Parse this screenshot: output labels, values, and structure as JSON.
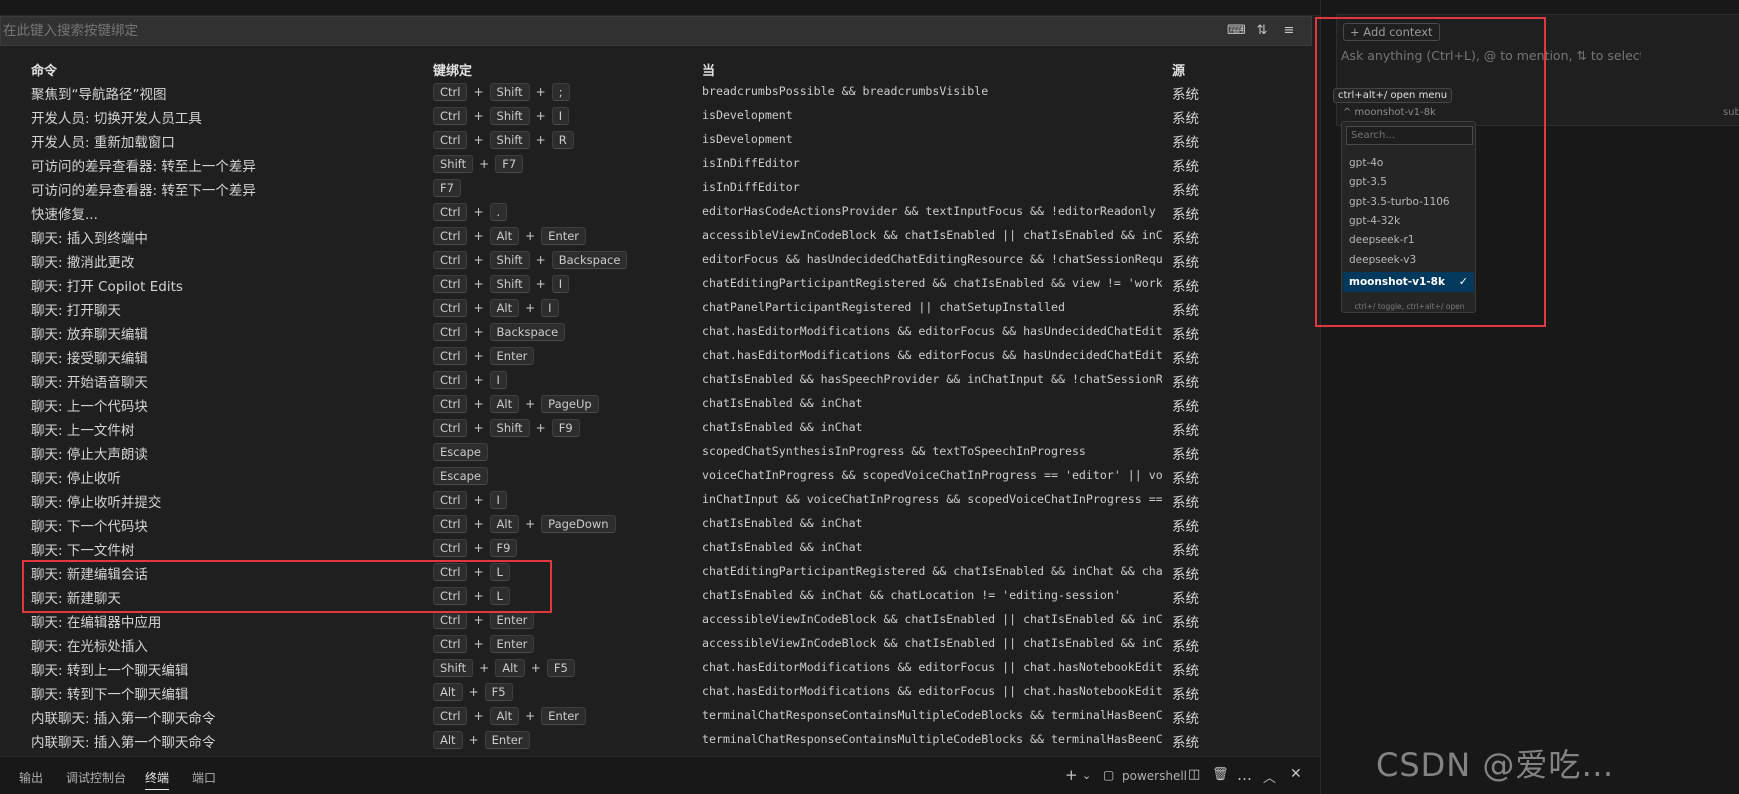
{
  "search": {
    "placeholder": "在此键入搜索按键绑定"
  },
  "columns": {
    "command": "命令",
    "keybinding": "键绑定",
    "when": "当",
    "source": "源"
  },
  "rows": [
    {
      "cmd": "聚焦到“导航路径”视图",
      "keys": [
        "Ctrl",
        "Shift",
        ";"
      ],
      "when": "breadcrumbsPossible && breadcrumbsVisible",
      "src": "系统"
    },
    {
      "cmd": "开发人员: 切换开发人员工具",
      "keys": [
        "Ctrl",
        "Shift",
        "I"
      ],
      "when": "isDevelopment",
      "src": "系统"
    },
    {
      "cmd": "开发人员: 重新加载窗口",
      "keys": [
        "Ctrl",
        "Shift",
        "R"
      ],
      "when": "isDevelopment",
      "src": "系统"
    },
    {
      "cmd": "可访问的差异查看器: 转至上一个差异",
      "keys": [
        "Shift",
        "F7"
      ],
      "when": "isInDiffEditor",
      "src": "系统"
    },
    {
      "cmd": "可访问的差异查看器: 转至下一个差异",
      "keys": [
        "F7"
      ],
      "when": "isInDiffEditor",
      "src": "系统"
    },
    {
      "cmd": "快速修复...",
      "keys": [
        "Ctrl",
        "."
      ],
      "when": "editorHasCodeActionsProvider && textInputFocus && !editorReadonly",
      "src": "系统"
    },
    {
      "cmd": "聊天: 插入到终端中",
      "keys": [
        "Ctrl",
        "Alt",
        "Enter"
      ],
      "when": "accessibleViewInCodeBlock && chatIsEnabled || chatIsEnabled && inChat",
      "src": "系统"
    },
    {
      "cmd": "聊天: 撤消此更改",
      "keys": [
        "Ctrl",
        "Shift",
        "Backspace"
      ],
      "when": "editorFocus && hasUndecidedChatEditingResource && !chatSessionRequestI…",
      "src": "系统"
    },
    {
      "cmd": "聊天: 打开 Copilot Edits",
      "keys": [
        "Ctrl",
        "Shift",
        "I"
      ],
      "when": "chatEditingParticipantRegistered && chatIsEnabled && view != 'workbenc…",
      "src": "系统"
    },
    {
      "cmd": "聊天: 打开聊天",
      "keys": [
        "Ctrl",
        "Alt",
        "I"
      ],
      "when": "chatPanelParticipantRegistered || chatSetupInstalled",
      "src": "系统"
    },
    {
      "cmd": "聊天: 放弃聊天编辑",
      "keys": [
        "Ctrl",
        "Backspace"
      ],
      "when": "chat.hasEditorModifications && editorFocus && hasUndecidedChatEditingR…",
      "src": "系统"
    },
    {
      "cmd": "聊天: 接受聊天编辑",
      "keys": [
        "Ctrl",
        "Enter"
      ],
      "when": "chat.hasEditorModifications && editorFocus && hasUndecidedChatEditingR…",
      "src": "系统"
    },
    {
      "cmd": "聊天: 开始语音聊天",
      "keys": [
        "Ctrl",
        "I"
      ],
      "when": "chatIsEnabled && hasSpeechProvider && inChatInput && !chatSessionReque…",
      "src": "系统"
    },
    {
      "cmd": "聊天: 上一个代码块",
      "keys": [
        "Ctrl",
        "Alt",
        "PageUp"
      ],
      "when": "chatIsEnabled && inChat",
      "src": "系统"
    },
    {
      "cmd": "聊天: 上一文件树",
      "keys": [
        "Ctrl",
        "Shift",
        "F9"
      ],
      "when": "chatIsEnabled && inChat",
      "src": "系统"
    },
    {
      "cmd": "聊天: 停止大声朗读",
      "keys": [
        "Escape"
      ],
      "when": "scopedChatSynthesisInProgress && textToSpeechInProgress",
      "src": "系统"
    },
    {
      "cmd": "聊天: 停止收听",
      "keys": [
        "Escape"
      ],
      "when": "voiceChatInProgress && scopedVoiceChatInProgress == 'editor' || voiceC…",
      "src": "系统"
    },
    {
      "cmd": "聊天: 停止收听并提交",
      "keys": [
        "Ctrl",
        "I"
      ],
      "when": "inChatInput && voiceChatInProgress && scopedVoiceChatInProgress == 'ed…",
      "src": "系统"
    },
    {
      "cmd": "聊天: 下一个代码块",
      "keys": [
        "Ctrl",
        "Alt",
        "PageDown"
      ],
      "when": "chatIsEnabled && inChat",
      "src": "系统"
    },
    {
      "cmd": "聊天: 下一文件树",
      "keys": [
        "Ctrl",
        "F9"
      ],
      "when": "chatIsEnabled && inChat",
      "src": "系统"
    },
    {
      "cmd": "聊天: 新建编辑会话",
      "keys": [
        "Ctrl",
        "L"
      ],
      "when": "chatEditingParticipantRegistered && chatIsEnabled && inChat && chatLoc…",
      "src": "系统"
    },
    {
      "cmd": "聊天: 新建聊天",
      "keys": [
        "Ctrl",
        "L"
      ],
      "when": "chatIsEnabled && inChat && chatLocation != 'editing-session'",
      "src": "系统"
    },
    {
      "cmd": "聊天: 在编辑器中应用",
      "keys": [
        "Ctrl",
        "Enter"
      ],
      "when": "accessibleViewInCodeBlock && chatIsEnabled || chatIsEnabled && inChat …",
      "src": "系统"
    },
    {
      "cmd": "聊天: 在光标处插入",
      "keys": [
        "Ctrl",
        "Enter"
      ],
      "when": "accessibleViewInCodeBlock && chatIsEnabled || chatIsEnabled && inChat …",
      "src": "系统"
    },
    {
      "cmd": "聊天: 转到上一个聊天编辑",
      "keys": [
        "Shift",
        "Alt",
        "F5"
      ],
      "when": "chat.hasEditorModifications && editorFocus || chat.hasNotebookEditorMo…",
      "src": "系统"
    },
    {
      "cmd": "聊天: 转到下一个聊天编辑",
      "keys": [
        "Alt",
        "F5"
      ],
      "when": "chat.hasEditorModifications && editorFocus || chat.hasNotebookEditorMo…",
      "src": "系统"
    },
    {
      "cmd": "内联聊天: 插入第一个聊天命令",
      "keys": [
        "Ctrl",
        "Alt",
        "Enter"
      ],
      "when": "terminalChatResponseContainsMultipleCodeBlocks && terminalHasBeenCreat…",
      "src": "系统"
    },
    {
      "cmd": "内联聊天: 插入第一个聊天命令",
      "keys": [
        "Alt",
        "Enter"
      ],
      "when": "terminalChatResponseContainsMultipleCodeBlocks && terminalHasBeenCreat…",
      "src": "系统"
    }
  ],
  "panel": {
    "tabs": [
      "输出",
      "调试控制台",
      "终端",
      "端口"
    ],
    "active_tab": 2,
    "terminal_name": "powershell",
    "icons": [
      "plus-icon",
      "chevron-down-icon",
      "terminal-icon",
      "split-icon",
      "trash-icon",
      "more-icon",
      "chevron-up-icon",
      "close-icon"
    ]
  },
  "chat": {
    "add_context": "+ Add context",
    "placeholder": "Ask anything (Ctrl+L), @ to mention, ⇅ to select",
    "tooltip": "ctrl+alt+/ open menu",
    "model_trigger": "^ moonshot-v1-8k",
    "submit": "subm",
    "dropdown": {
      "search_placeholder": "Search...",
      "items": [
        "gpt-4o",
        "gpt-3.5",
        "gpt-3.5-turbo-1106",
        "gpt-4-32k",
        "deepseek-r1",
        "deepseek-v3",
        "moonshot-v1-8k"
      ],
      "selected": "moonshot-v1-8k",
      "hint": "ctrl+/ toggle, ctrl+alt+/ open"
    }
  },
  "watermark": "CSDN @爱吃…",
  "colors": {
    "highlight": "#e0383e",
    "selected": "#04395e",
    "background": "#1f1f1f"
  }
}
